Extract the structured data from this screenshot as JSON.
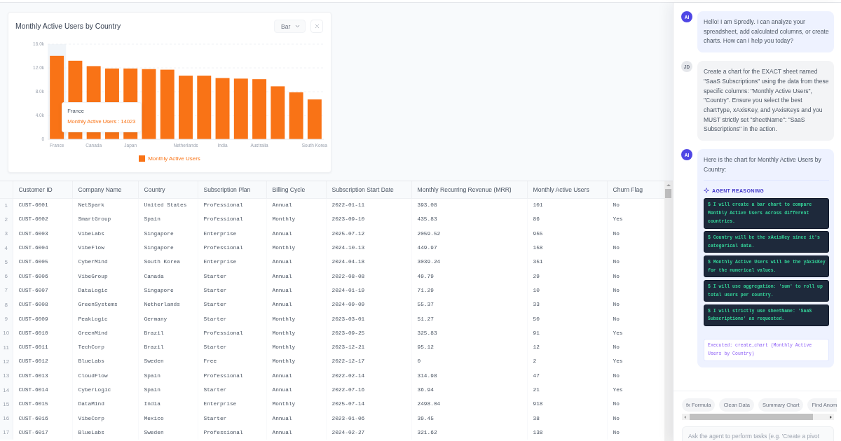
{
  "chart_card": {
    "title": "Monthly Active Users by Country",
    "chart_type_select": {
      "value": "Bar"
    },
    "chart_data": {
      "type": "bar",
      "categories": [
        "France",
        null,
        "Canada",
        null,
        "Japan",
        null,
        null,
        "Netherlands",
        null,
        "India",
        null,
        "Australia",
        null,
        null,
        "South Korea"
      ],
      "series": [
        {
          "name": "Monthly Active Users",
          "color": "#f97316",
          "values": [
            14023,
            13200,
            12300,
            11900,
            11900,
            11800,
            11700,
            10700,
            10700,
            10300,
            10200,
            10100,
            8900,
            7900,
            6700
          ]
        }
      ],
      "ylim": [
        0,
        16000
      ],
      "yticks": [
        {
          "value": 0,
          "label": "0"
        },
        {
          "value": 4000,
          "label": "4.0k"
        },
        {
          "value": 8000,
          "label": "8.0k"
        },
        {
          "value": 12000,
          "label": "12.0k"
        },
        {
          "value": 16000,
          "label": "16.0k"
        }
      ],
      "grid": true
    },
    "tooltip": {
      "title": "France",
      "text": "Monthly Active Users : 14023"
    }
  },
  "table": {
    "columns": [
      "Customer ID",
      "Company Name",
      "Country",
      "Subscription Plan",
      "Billing Cycle",
      "Subscription Start Date",
      "Monthly Recurring Revenue (MRR)",
      "Monthly Active Users",
      "Churn Flag"
    ],
    "rows": [
      {
        "number": "1",
        "cells": [
          "CUST-6001",
          "NetSpark",
          "United States",
          "Professional",
          "Annual",
          "2022-01-11",
          "393.08",
          "101",
          "No"
        ]
      },
      {
        "number": "2",
        "cells": [
          "CUST-6002",
          "SmartGroup",
          "Spain",
          "Professional",
          "Monthly",
          "2023-09-10",
          "435.83",
          "86",
          "Yes"
        ]
      },
      {
        "number": "3",
        "cells": [
          "CUST-6003",
          "VibeLabs",
          "Singapore",
          "Enterprise",
          "Annual",
          "2025-07-12",
          "2059.52",
          "955",
          "No"
        ]
      },
      {
        "number": "4",
        "cells": [
          "CUST-6004",
          "VibeFlow",
          "Singapore",
          "Professional",
          "Monthly",
          "2024-10-13",
          "449.97",
          "158",
          "No"
        ]
      },
      {
        "number": "5",
        "cells": [
          "CUST-6005",
          "CyberMind",
          "South Korea",
          "Enterprise",
          "Annual",
          "2024-04-18",
          "3039.24",
          "351",
          "No"
        ]
      },
      {
        "number": "6",
        "cells": [
          "CUST-6006",
          "VibeGroup",
          "Canada",
          "Starter",
          "Annual",
          "2022-08-08",
          "49.79",
          "29",
          "No"
        ]
      },
      {
        "number": "7",
        "cells": [
          "CUST-6007",
          "DataLogic",
          "Singapore",
          "Starter",
          "Annual",
          "2024-01-19",
          "71.29",
          "10",
          "No"
        ]
      },
      {
        "number": "8",
        "cells": [
          "CUST-6008",
          "GreenSystems",
          "Netherlands",
          "Starter",
          "Annual",
          "2024-09-09",
          "55.37",
          "33",
          "No"
        ]
      },
      {
        "number": "9",
        "cells": [
          "CUST-6009",
          "PeakLogic",
          "Germany",
          "Starter",
          "Monthly",
          "2023-03-01",
          "51.27",
          "50",
          "No"
        ]
      },
      {
        "number": "10",
        "cells": [
          "CUST-6010",
          "GreenMind",
          "Brazil",
          "Professional",
          "Monthly",
          "2023-09-25",
          "325.83",
          "91",
          "Yes"
        ]
      },
      {
        "number": "11",
        "cells": [
          "CUST-6011",
          "TechCorp",
          "Brazil",
          "Starter",
          "Monthly",
          "2023-12-21",
          "95.12",
          "12",
          "No"
        ]
      },
      {
        "number": "12",
        "cells": [
          "CUST-6012",
          "BlueLabs",
          "Sweden",
          "Free",
          "Monthly",
          "2022-12-17",
          "0",
          "2",
          "Yes"
        ]
      },
      {
        "number": "13",
        "cells": [
          "CUST-6013",
          "CloudFlow",
          "Spain",
          "Professional",
          "Annual",
          "2022-02-14",
          "314.98",
          "47",
          "No"
        ]
      },
      {
        "number": "14",
        "cells": [
          "CUST-6014",
          "CyberLogic",
          "Spain",
          "Starter",
          "Annual",
          "2022-07-16",
          "36.94",
          "21",
          "Yes"
        ]
      },
      {
        "number": "15",
        "cells": [
          "CUST-6015",
          "DataMind",
          "India",
          "Enterprise",
          "Monthly",
          "2025-07-14",
          "2498.04",
          "918",
          "No"
        ]
      },
      {
        "number": "16",
        "cells": [
          "CUST-6016",
          "VibeCorp",
          "Mexico",
          "Starter",
          "Annual",
          "2023-01-06",
          "39.45",
          "38",
          "No"
        ]
      },
      {
        "number": "17",
        "cells": [
          "CUST-6017",
          "BlueLabs",
          "Sweden",
          "Professional",
          "Annual",
          "2024-02-27",
          "321.62",
          "138",
          "No"
        ]
      }
    ]
  },
  "chat": {
    "messages": [
      {
        "kind": "ai",
        "avatar": "AI",
        "text": "Hello! I am Spredly. I can analyze your spreadsheet, add calculated columns, or create charts. How can I help you today?"
      },
      {
        "kind": "user",
        "avatar": "JD",
        "text": "Create a chart for the EXACT sheet named \"SaaS Subscriptions\" using the data from these specific columns: \"Monthly Active Users\", \"Country\". Ensure you select the best chartType, xAxisKey, and yAxisKeys and you MUST strictly set \"sheetName\": \"SaaS Subscriptions\" in the action."
      },
      {
        "kind": "ai",
        "avatar": "AI",
        "text": "Here is the chart for Monthly Active Users by Country:",
        "reasoning": {
          "title": "AGENT REASONING",
          "steps": [
            "$ I will create a bar chart to compare Monthly Active Users across different countries.",
            "$ Country will be the xAxisKey since it's categorical data.",
            "$ Monthly Active Users will be the yAxisKey for the numerical values.",
            "$ I will use aggregation: 'sum' to roll up total users per country.",
            "$ I will strictly use sheetName: 'SaaS Subscriptions' as requested."
          ]
        },
        "executed": "Executed: create_chart (Monthly Active Users by Country)"
      }
    ],
    "quick_actions": [
      "fx Formula",
      "Clean Data",
      "Summary Chart",
      "Find Anom"
    ],
    "input": {
      "placeholder": "Ask the agent to perform tasks (e.g. 'Create a pivot"
    }
  }
}
